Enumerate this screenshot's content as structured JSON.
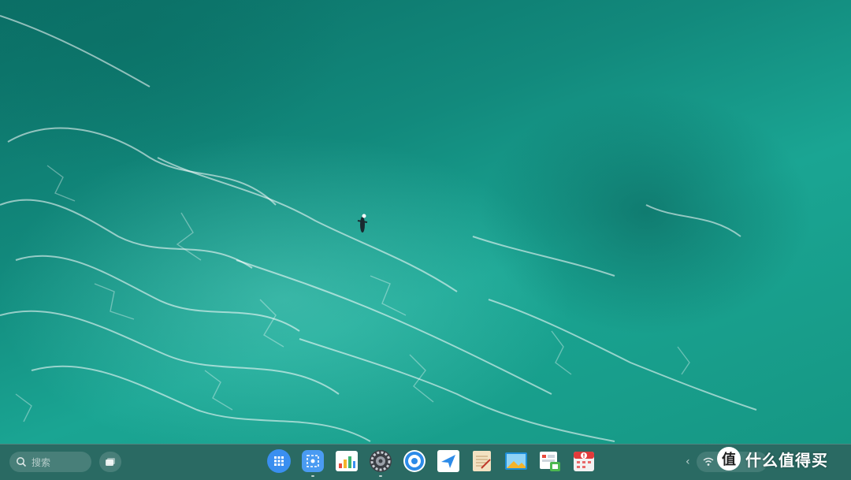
{
  "taskbar": {
    "search_placeholder": "搜索"
  },
  "dock_apps": [
    {
      "name": "launcher",
      "icon": "grid-icon"
    },
    {
      "name": "screenshot",
      "icon": "screenshot-icon"
    },
    {
      "name": "app-store",
      "icon": "app-store-icon"
    },
    {
      "name": "system-settings",
      "icon": "gear-icon"
    },
    {
      "name": "browser",
      "icon": "browser-icon"
    },
    {
      "name": "messaging",
      "icon": "send-icon"
    },
    {
      "name": "notes",
      "icon": "notes-icon"
    },
    {
      "name": "image-viewer",
      "icon": "image-icon"
    },
    {
      "name": "file-manager",
      "icon": "file-manager-icon"
    },
    {
      "name": "calendar-alert",
      "icon": "alert-icon"
    }
  ],
  "watermark": {
    "logo_char": "值",
    "text": "什么值得买"
  },
  "colors": {
    "sea_dark": "#0b6f66",
    "sea_light": "#1aa593",
    "dock_bg": "#2a6a63",
    "accent_blue": "#3a8ff0"
  }
}
